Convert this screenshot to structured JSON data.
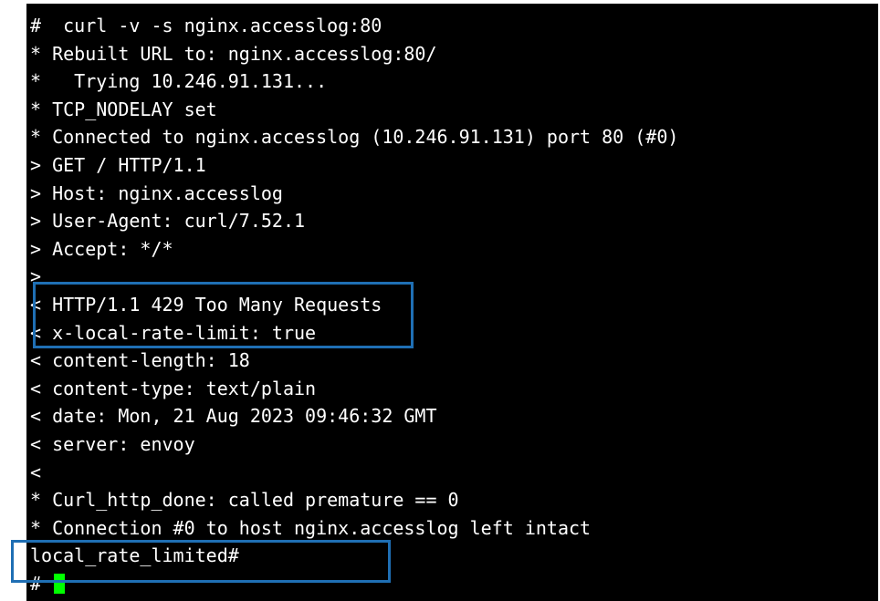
{
  "terminal": {
    "lines": [
      "#  curl -v -s nginx.accesslog:80",
      "* Rebuilt URL to: nginx.accesslog:80/",
      "*   Trying 10.246.91.131...",
      "* TCP_NODELAY set",
      "* Connected to nginx.accesslog (10.246.91.131) port 80 (#0)",
      "> GET / HTTP/1.1",
      "> Host: nginx.accesslog",
      "> User-Agent: curl/7.52.1",
      "> Accept: */*",
      ">",
      "< HTTP/1.1 429 Too Many Requests",
      "< x-local-rate-limit: true",
      "< content-length: 18",
      "< content-type: text/plain",
      "< date: Mon, 21 Aug 2023 09:46:32 GMT",
      "< server: envoy",
      "<",
      "* Curl_http_done: called premature == 0",
      "* Connection #0 to host nginx.accesslog left intact",
      "local_rate_limited#",
      "# "
    ]
  },
  "colors": {
    "background": "#000000",
    "text": "#ffffff",
    "cursor": "#00ff00",
    "highlight_border": "#1f6fb4"
  }
}
